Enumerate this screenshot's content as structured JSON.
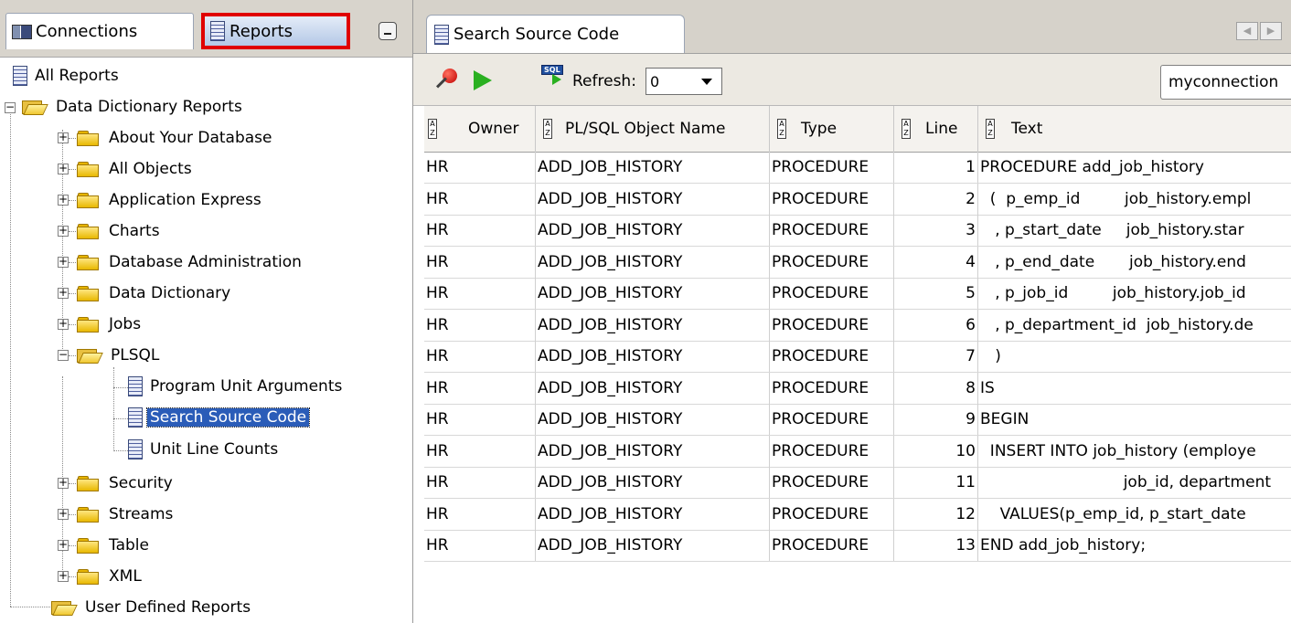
{
  "left_panel": {
    "tabs": {
      "connections": "Connections",
      "reports": "Reports"
    },
    "tree": {
      "all_reports": "All Reports",
      "data_dictionary_reports": "Data Dictionary Reports",
      "folders_top": [
        "About Your Database",
        "All Objects",
        "Application Express",
        "Charts",
        "Database Administration",
        "Data Dictionary",
        "Jobs"
      ],
      "plsql": "PLSQL",
      "plsql_items": [
        "Program Unit Arguments",
        "Search Source Code",
        "Unit Line Counts"
      ],
      "folders_bottom": [
        "Security",
        "Streams",
        "Table",
        "XML"
      ],
      "user_defined_reports": "User Defined Reports"
    }
  },
  "right_panel": {
    "tab_title": "Search Source Code",
    "toolbar": {
      "refresh_label": "Refresh:",
      "refresh_value": "0",
      "connection": "myconnection"
    },
    "grid": {
      "columns": [
        "Owner",
        "PL/SQL Object Name",
        "Type",
        "Line",
        "Text"
      ],
      "rows": [
        [
          "HR",
          "ADD_JOB_HISTORY",
          "PROCEDURE",
          "1",
          "PROCEDURE add_job_history"
        ],
        [
          "HR",
          "ADD_JOB_HISTORY",
          "PROCEDURE",
          "2",
          "  (  p_emp_id         job_history.empl"
        ],
        [
          "HR",
          "ADD_JOB_HISTORY",
          "PROCEDURE",
          "3",
          "   , p_start_date     job_history.star"
        ],
        [
          "HR",
          "ADD_JOB_HISTORY",
          "PROCEDURE",
          "4",
          "   , p_end_date       job_history.end"
        ],
        [
          "HR",
          "ADD_JOB_HISTORY",
          "PROCEDURE",
          "5",
          "   , p_job_id         job_history.job_id"
        ],
        [
          "HR",
          "ADD_JOB_HISTORY",
          "PROCEDURE",
          "6",
          "   , p_department_id  job_history.de"
        ],
        [
          "HR",
          "ADD_JOB_HISTORY",
          "PROCEDURE",
          "7",
          "   )"
        ],
        [
          "HR",
          "ADD_JOB_HISTORY",
          "PROCEDURE",
          "8",
          "IS"
        ],
        [
          "HR",
          "ADD_JOB_HISTORY",
          "PROCEDURE",
          "9",
          "BEGIN"
        ],
        [
          "HR",
          "ADD_JOB_HISTORY",
          "PROCEDURE",
          "10",
          "  INSERT INTO job_history (employe"
        ],
        [
          "HR",
          "ADD_JOB_HISTORY",
          "PROCEDURE",
          "11",
          "                             job_id, department"
        ],
        [
          "HR",
          "ADD_JOB_HISTORY",
          "PROCEDURE",
          "12",
          "    VALUES(p_emp_id, p_start_date"
        ],
        [
          "HR",
          "ADD_JOB_HISTORY",
          "PROCEDURE",
          "13",
          "END add_job_history;"
        ]
      ]
    }
  },
  "colors": {
    "highlight_box": "#e00000",
    "selection": "#2a5cb8",
    "run_green": "#2ab020"
  },
  "icons": [
    "connections-icon",
    "reports-icon",
    "minimize-icon",
    "report-doc-icon",
    "folder-icon",
    "folder-open-icon",
    "pin-icon",
    "run-icon",
    "sql-refresh-icon",
    "sort-icon"
  ]
}
